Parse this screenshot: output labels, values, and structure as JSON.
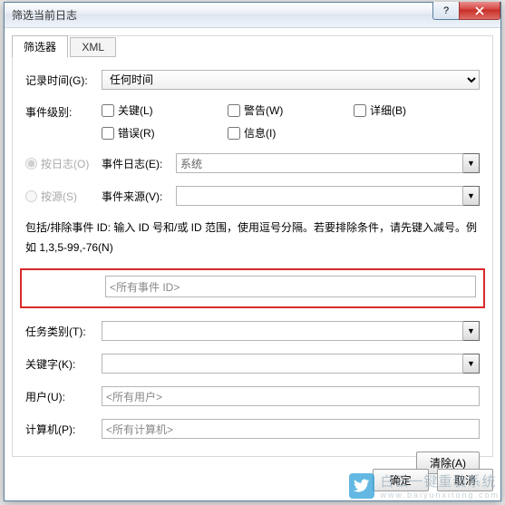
{
  "window": {
    "title": "筛选当前日志"
  },
  "tabs": {
    "filter": "筛选器",
    "xml": "XML"
  },
  "labels": {
    "logged": "记录时间(G):",
    "level": "事件级别:",
    "byLog": "按日志(O)",
    "bySource": "按源(S)",
    "eventLogs": "事件日志(E):",
    "eventSources": "事件来源(V):",
    "taskCategory": "任务类别(T):",
    "keywords": "关键字(K):",
    "user": "用户(U):",
    "computer": "计算机(P):"
  },
  "values": {
    "logged": "任何时间",
    "eventLogs": "系统",
    "eventSources": "",
    "eventIds": "<所有事件 ID>",
    "taskCategory": "",
    "keywords": "",
    "user": "<所有用户>",
    "computer": "<所有计算机>"
  },
  "checks": {
    "critical": "关键(L)",
    "warning": "警告(W)",
    "verbose": "详细(B)",
    "error": "错误(R)",
    "information": "信息(I)"
  },
  "hint": "包括/排除事件 ID: 输入 ID 号和/或 ID 范围，使用逗号分隔。若要排除条件，请先键入减号。例如 1,3,5-99,-76(N)",
  "buttons": {
    "clear": "清除(A)",
    "ok": "确定",
    "cancel": "取消"
  },
  "watermark": {
    "brand": "白云一键重装系统",
    "url": "www.baiyunxitong.com"
  }
}
